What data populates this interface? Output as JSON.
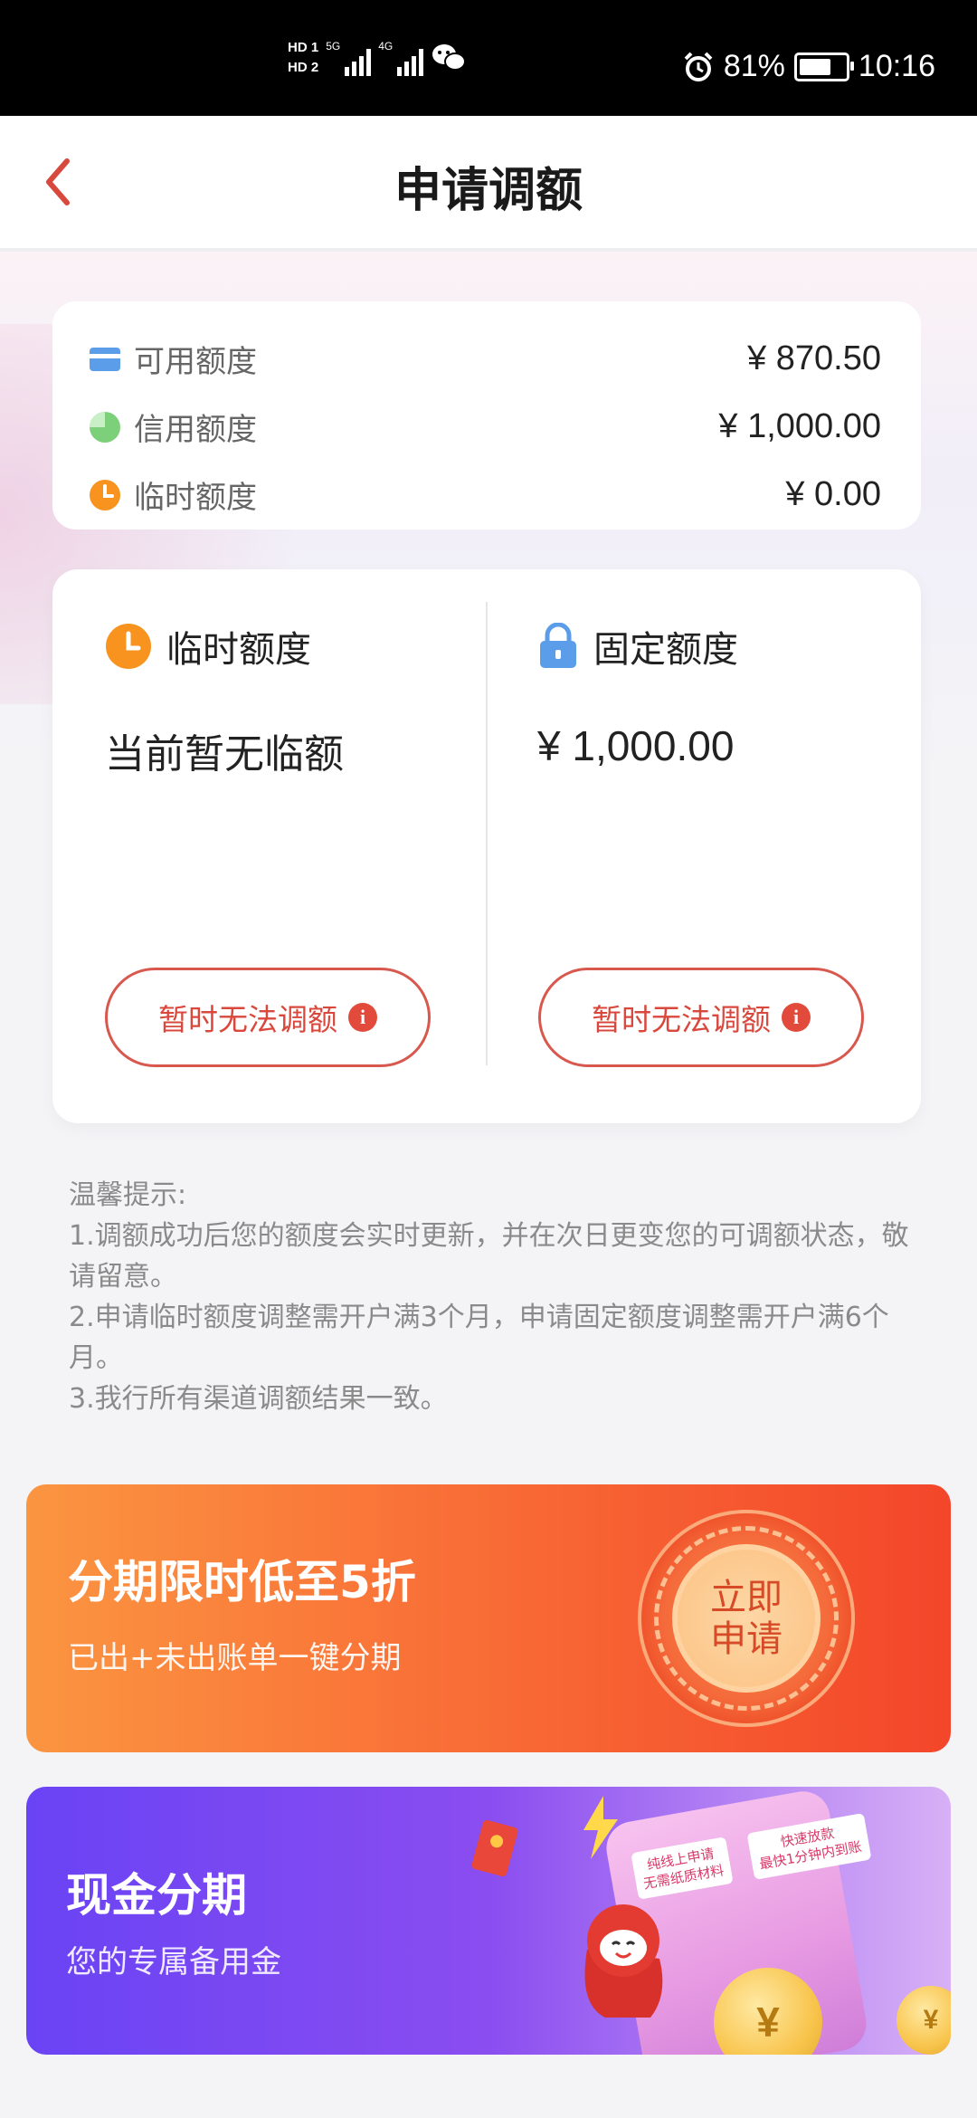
{
  "status_bar": {
    "hd1": "HD 1",
    "hd2": "HD 2",
    "net1": "5G",
    "net2": "4G",
    "battery_percent": "81%",
    "time": "10:16",
    "icons": [
      "signal-icon",
      "wechat-icon",
      "alarm-icon",
      "battery-icon"
    ]
  },
  "header": {
    "title": "申请调额",
    "back_icon": "chevron-left-icon"
  },
  "summary": {
    "rows": [
      {
        "label": "可用额度",
        "value": "¥ 870.50",
        "icon": "card-icon"
      },
      {
        "label": "信用额度",
        "value": "¥ 1,000.00",
        "icon": "pie-icon"
      },
      {
        "label": "临时额度",
        "value": "¥ 0.00",
        "icon": "clock-icon"
      }
    ]
  },
  "quota": {
    "temporary": {
      "title": "临时额度",
      "value": "当前暂无临额",
      "button": "暂时无法调额",
      "icon": "clock-icon"
    },
    "fixed": {
      "title": "固定额度",
      "value": "¥ 1,000.00",
      "button": "暂时无法调额",
      "icon": "lock-icon"
    },
    "info_glyph": "i"
  },
  "tips": {
    "heading": "温馨提示:",
    "items": [
      "1.调额成功后您的额度会实时更新，并在次日更变您的可调额状态，敬请留意。",
      "2.申请临时额度调整需开户满3个月，申请固定额度调整需开户满6个月。",
      "3.我行所有渠道调额结果一致。"
    ]
  },
  "banners": {
    "installment": {
      "title": "分期限时低至5折",
      "subtitle": "已出+未出账单一键分期",
      "apply_line1": "立即",
      "apply_line2": "申请"
    },
    "cash": {
      "title": "现金分期",
      "subtitle": "您的专属备用金",
      "tag1_line1": "纯线上申请",
      "tag1_line2": "无需纸质材料",
      "tag2_line1": "快速放款",
      "tag2_line2": "最快1分钟内到账",
      "coin_glyph": "¥"
    }
  },
  "colors": {
    "accent_red": "#d9483d",
    "orange_icon": "#f7931e",
    "green_icon": "#7dd07a",
    "blue_icon": "#5b9de8",
    "banner_orange": "#f96f37",
    "banner_purple": "#6a43f4"
  }
}
